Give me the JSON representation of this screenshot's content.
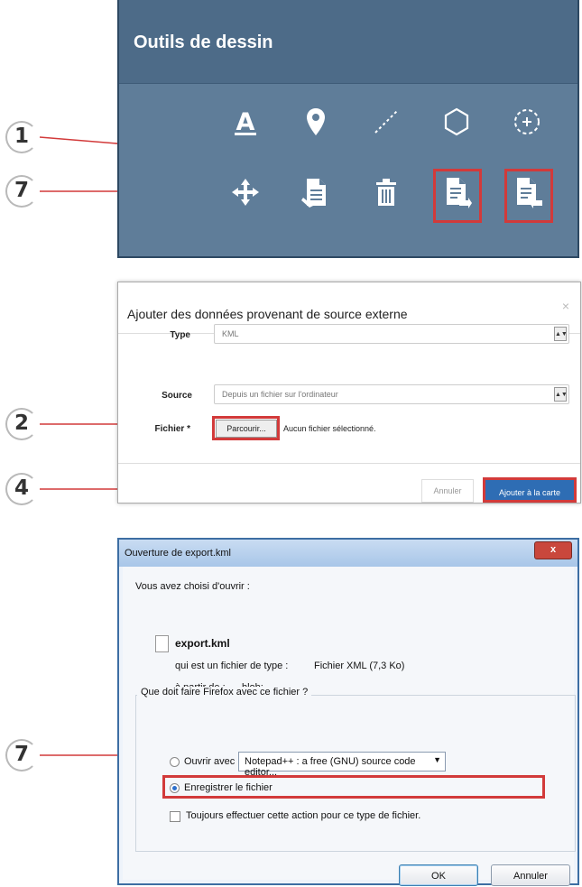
{
  "colors": {
    "highlight": "#d23a3a",
    "toolbar_bg": "#5f7d99",
    "primary_button": "#2e6db4"
  },
  "callouts": [
    "1",
    "7",
    "2",
    "4",
    "7"
  ],
  "drawing_tools": {
    "title": "Outils de dessin",
    "row1_icons": [
      "text-icon",
      "marker-icon",
      "line-icon",
      "polygon-icon",
      "circle-icon"
    ],
    "row2_icons": [
      "move-icon",
      "edit-icon",
      "delete-icon",
      "export-icon",
      "import-icon"
    ]
  },
  "external_data_dialog": {
    "title": "Ajouter des données provenant de source externe",
    "close": "×",
    "type_label": "Type",
    "type_value": "KML",
    "source_label": "Source",
    "source_value": "Depuis un fichier sur l'ordinateur",
    "file_label": "Fichier *",
    "browse_button": "Parcourir...",
    "no_file_text": "Aucun fichier sélectionné.",
    "cancel_button": "Annuler",
    "add_button": "Ajouter à la carte"
  },
  "open_dialog": {
    "title": "Ouverture de export.kml",
    "close": "x",
    "intro": "Vous avez choisi d'ouvrir :",
    "filename": "export.kml",
    "type_prefix": "qui est un fichier de type :",
    "type_value": "Fichier XML (7,3 Ko)",
    "from_prefix": "à partir de :",
    "from_value": "blob:",
    "question": "Que doit faire Firefox avec ce fichier ?",
    "open_with_label": "Ouvrir avec",
    "open_with_app": "Notepad++ : a free (GNU) source code editor...",
    "save_label": "Enregistrer le fichier",
    "always_label": "Toujours effectuer cette action pour ce type de fichier.",
    "ok_button": "OK",
    "cancel_button": "Annuler"
  }
}
